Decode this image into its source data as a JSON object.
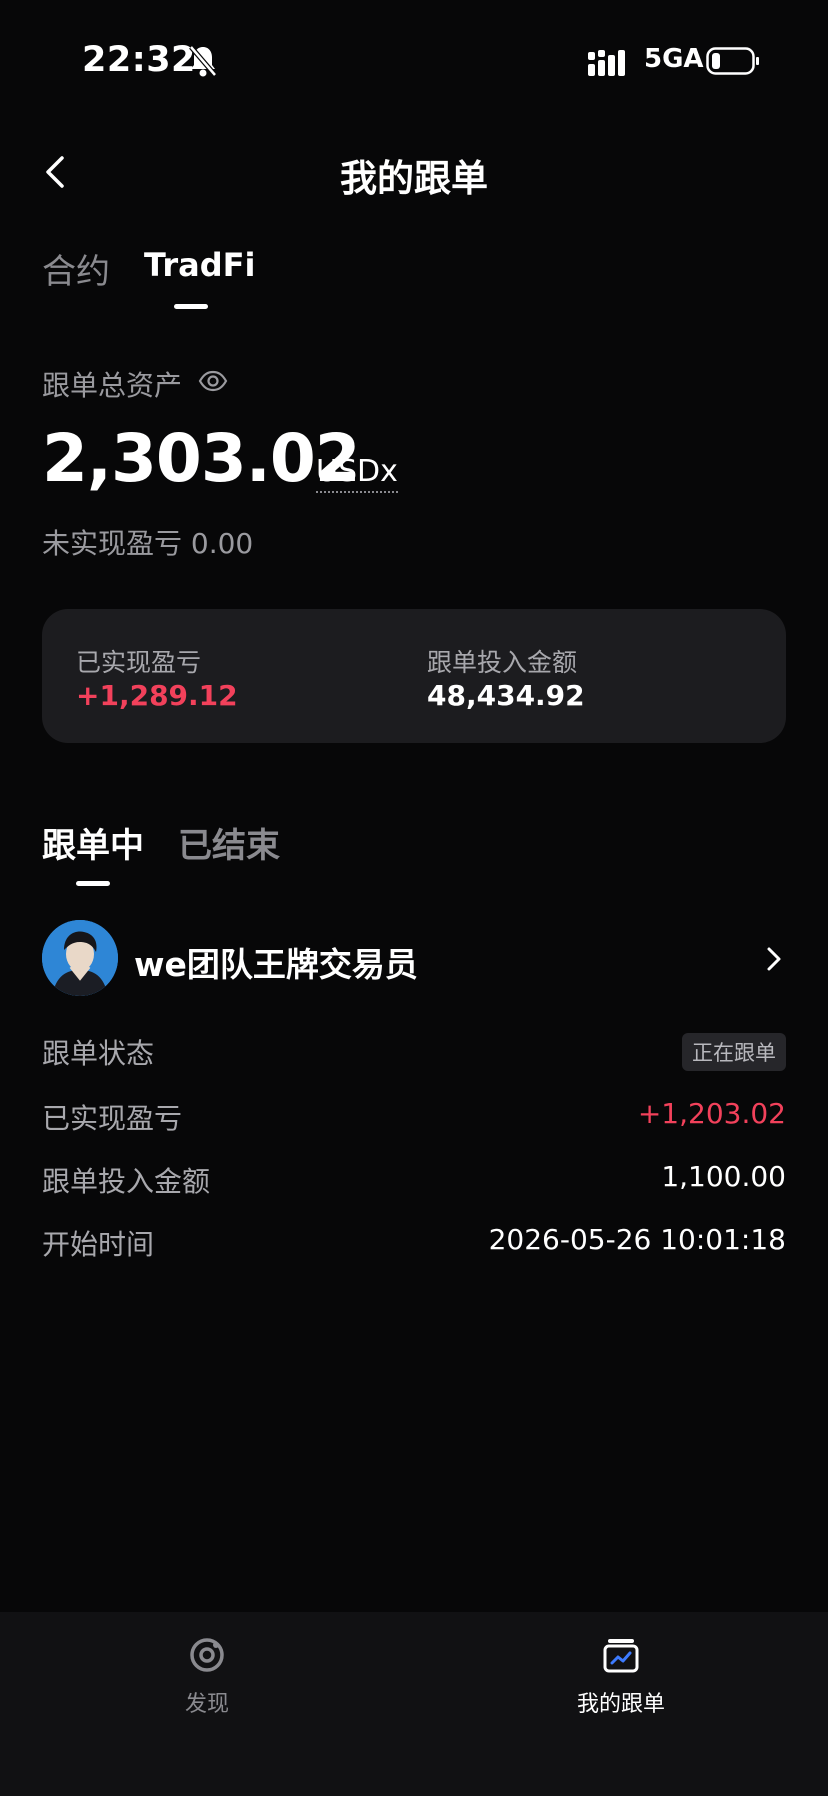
{
  "status_bar": {
    "time": "22:32",
    "network": "5GA"
  },
  "header": {
    "title": "我的跟单"
  },
  "top_tabs": [
    {
      "label": "合约",
      "active": false
    },
    {
      "label": "TradFi",
      "active": true
    }
  ],
  "assets": {
    "label": "跟单总资产",
    "value": "2,303.02",
    "unit": "USDx",
    "unrealized_text": "未实现盈亏 0.00"
  },
  "summary_card": {
    "realized_label": "已实现盈亏",
    "realized_value": "+1,289.12",
    "invested_label": "跟单投入金额",
    "invested_value": "48,434.92"
  },
  "list_tabs": [
    {
      "label": "跟单中",
      "active": true
    },
    {
      "label": "已结束",
      "active": false
    }
  ],
  "trader": {
    "name": "we团队王牌交易员",
    "rows": {
      "status_label": "跟单状态",
      "status_value": "正在跟单",
      "realized_label": "已实现盈亏",
      "realized_value": "+1,203.02",
      "invested_label": "跟单投入金额",
      "invested_value": "1,100.00",
      "start_label": "开始时间",
      "start_value": "2026-05-26 10:01:18"
    }
  },
  "bottom_nav": [
    {
      "label": "发现",
      "icon": "discover-icon",
      "active": false
    },
    {
      "label": "我的跟单",
      "icon": "my-copy-trade-icon",
      "active": true
    }
  ],
  "colors": {
    "background": "#070708",
    "card": "#1c1c1f",
    "positive": "#f2415b",
    "muted": "#8a8a8f"
  }
}
